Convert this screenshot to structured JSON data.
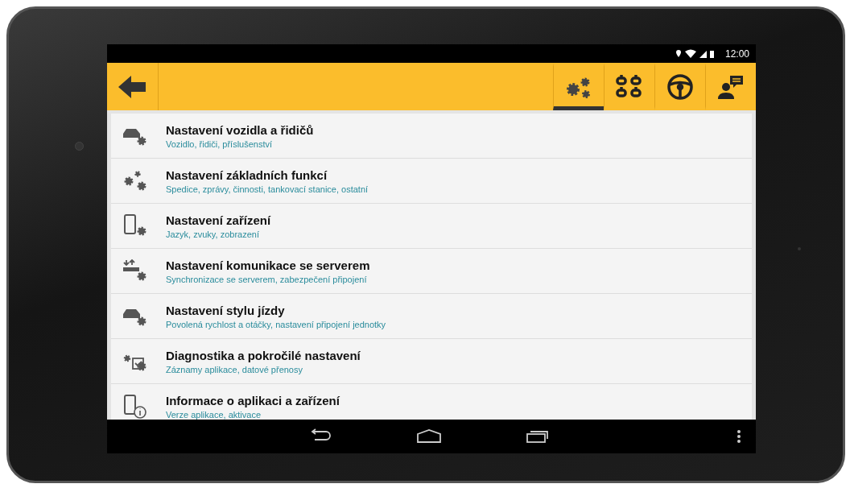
{
  "status_bar": {
    "time": "12:00"
  },
  "toolbar": {
    "tabs": [
      {
        "kind": "gears",
        "selected": true
      },
      {
        "kind": "grid",
        "selected": false
      },
      {
        "kind": "wheel",
        "selected": false
      },
      {
        "kind": "person-chat",
        "selected": false
      }
    ]
  },
  "settings": [
    {
      "kind": "car-gear",
      "title": "Nastavení vozidla a řidičů",
      "subtitle": "Vozidlo, řidiči, příslušenství"
    },
    {
      "kind": "gears",
      "title": "Nastavení základních funkcí",
      "subtitle": "Spedice, zprávy, činnosti, tankovací stanice, ostatní"
    },
    {
      "kind": "phone-gear",
      "title": "Nastavení zařízení",
      "subtitle": "Jazyk, zvuky, zobrazení"
    },
    {
      "kind": "sync-gear",
      "title": "Nastavení komunikace se serverem",
      "subtitle": "Synchronizace se serverem, zabezpečení připojení"
    },
    {
      "kind": "car-gear",
      "title": "Nastavení stylu jízdy",
      "subtitle": "Povolená rychlost a otáčky, nastavení připojení jednotky"
    },
    {
      "kind": "check-gear",
      "title": "Diagnostika a pokročilé nastavení",
      "subtitle": "Záznamy aplikace, datové přenosy"
    },
    {
      "kind": "phone-info",
      "title": "Informace o aplikaci a zařízení",
      "subtitle": "Verze aplikace, aktivace"
    }
  ]
}
